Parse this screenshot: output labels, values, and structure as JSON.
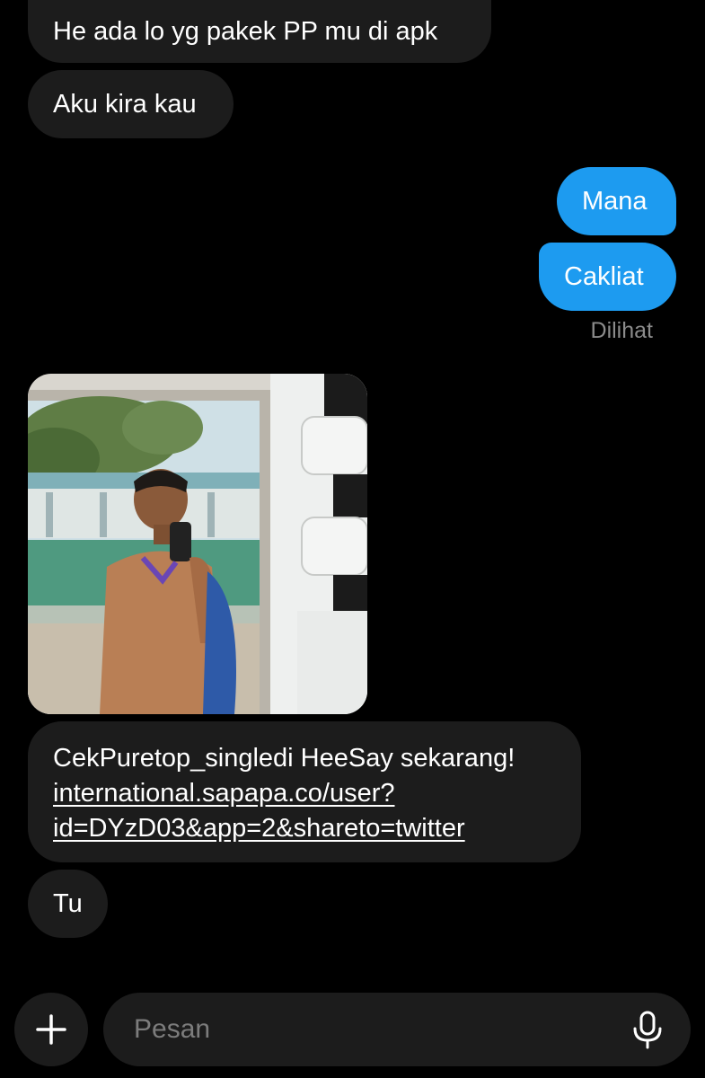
{
  "messages": {
    "m1": "He ada lo yg pakek PP mu di apk",
    "m2": "Aku kira kau",
    "m3": "Mana",
    "m4": "Cakliat",
    "seen_label": "Dilihat",
    "share_text": "CekPuretop_singledi HeeSay sekarang!",
    "share_link_line1": "international.sapapa.co/user?",
    "share_link_line2": "id=DYzD03&app=2&shareto=twitter",
    "m6": "Tu"
  },
  "composer": {
    "placeholder": "Pesan",
    "plus_icon": "plus-icon",
    "mic_icon": "microphone-icon"
  },
  "colors": {
    "background": "#000000",
    "incoming_bubble": "#1c1c1c",
    "outgoing_bubble": "#1d9bf0",
    "muted_text": "#8b8b8b"
  }
}
